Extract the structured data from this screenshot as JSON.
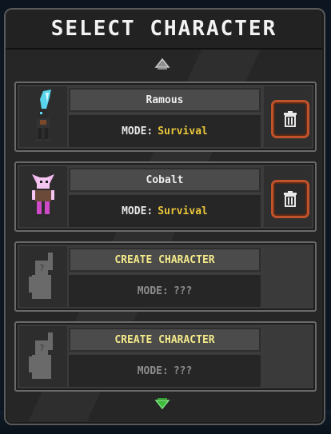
{
  "title": "SELECT CHARACTER",
  "colors": {
    "panel": "#2c2c2c",
    "mode_value": "#e9c53a",
    "create_text": "#f3e98a",
    "delete_border": "#c0532b",
    "scroll_down_arrow": "#3cbd3c"
  },
  "slots": [
    {
      "name": "Ramous",
      "mode_label": "MODE:",
      "mode_value": "Survival",
      "portrait_icon": "ramous-character-sprite",
      "action_icon": "trash-icon"
    },
    {
      "name": "Cobalt",
      "mode_label": "MODE:",
      "mode_value": "Survival",
      "portrait_icon": "cobalt-character-sprite",
      "action_icon": "trash-icon"
    },
    {
      "name": "CREATE CHARACTER",
      "mode_label": "MODE:",
      "mode_value": "???",
      "portrait_icon": "placeholder-silhouette"
    },
    {
      "name": "CREATE CHARACTER",
      "mode_label": "MODE:",
      "mode_value": "???",
      "portrait_icon": "placeholder-silhouette"
    }
  ]
}
